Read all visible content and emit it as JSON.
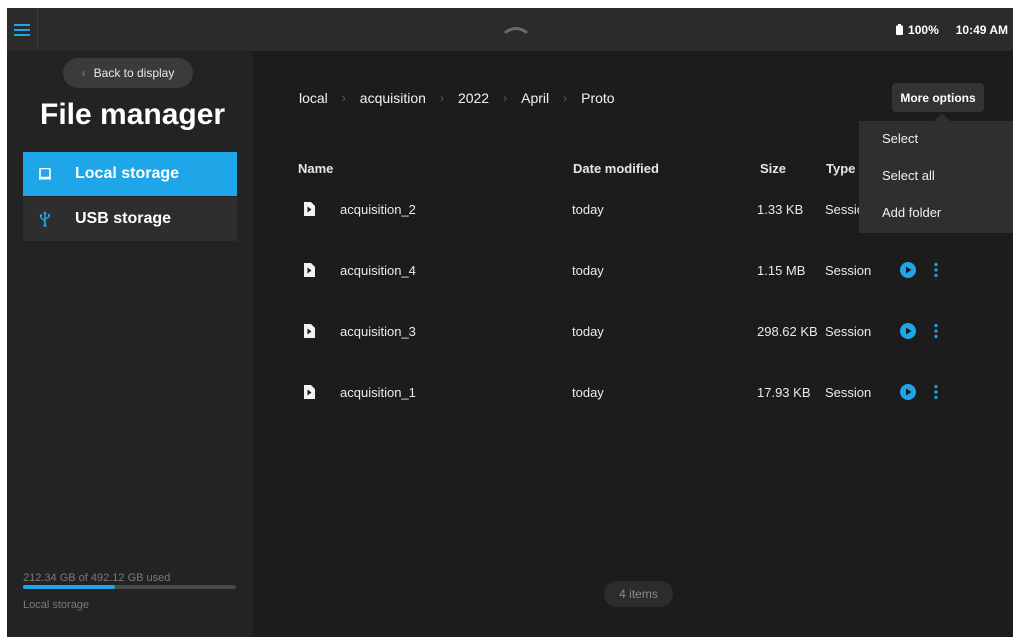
{
  "topbar": {
    "battery": "100%",
    "time": "10:49 AM"
  },
  "sidebar": {
    "back_label": "Back to display",
    "title": "File manager",
    "items": [
      {
        "label": "Local storage",
        "icon": "tablet-icon",
        "selected": true
      },
      {
        "label": "USB storage",
        "icon": "usb-icon",
        "selected": false
      }
    ],
    "storage": {
      "used_text": "212.34 GB of 492.12 GB used",
      "used_fraction": 0.4315,
      "label": "Local storage"
    }
  },
  "breadcrumb": [
    "local",
    "acquisition",
    "2022",
    "April",
    "Proto"
  ],
  "more_options_label": "More options",
  "menu": {
    "items": [
      "Select",
      "Select all",
      "Add folder"
    ]
  },
  "table": {
    "headers": {
      "name": "Name",
      "date": "Date modified",
      "size": "Size",
      "type": "Type"
    },
    "rows": [
      {
        "name": "acquisition_2",
        "date": "today",
        "size": "1.33 KB",
        "type": "Session"
      },
      {
        "name": "acquisition_4",
        "date": "today",
        "size": "1.15 MB",
        "type": "Session"
      },
      {
        "name": "acquisition_3",
        "date": "today",
        "size": "298.62 KB",
        "type": "Session"
      },
      {
        "name": "acquisition_1",
        "date": "today",
        "size": "17.93 KB",
        "type": "Session"
      }
    ]
  },
  "item_count": "4 items",
  "colors": {
    "accent": "#1fa6e8",
    "background": "#1c1c1c",
    "sidebar": "#232323",
    "topbar": "#2b2b2b"
  }
}
